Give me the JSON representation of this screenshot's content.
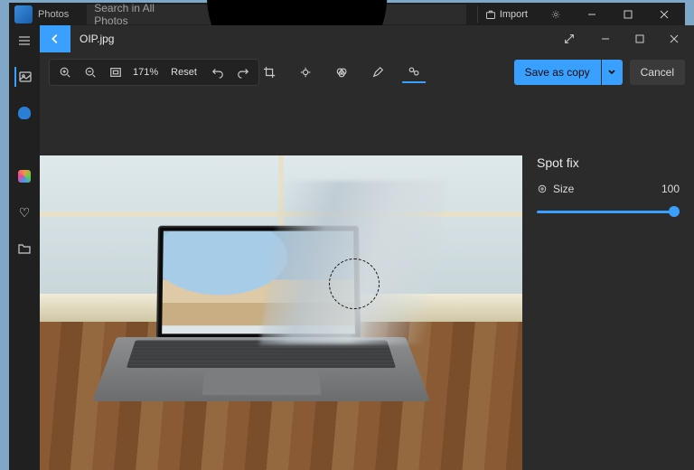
{
  "bgWindow": {
    "appTitle": "Photos",
    "searchPlaceholder": "Search in All Photos",
    "importLabel": "Import"
  },
  "editor": {
    "filename": "OIP.jpg",
    "zoomPercent": "171%",
    "resetLabel": "Reset",
    "saveLabel": "Save as copy",
    "cancelLabel": "Cancel"
  },
  "panel": {
    "title": "Spot fix",
    "sliderLabel": "Size",
    "sliderValue": "100"
  },
  "colors": {
    "accent": "#3aa0ff"
  }
}
